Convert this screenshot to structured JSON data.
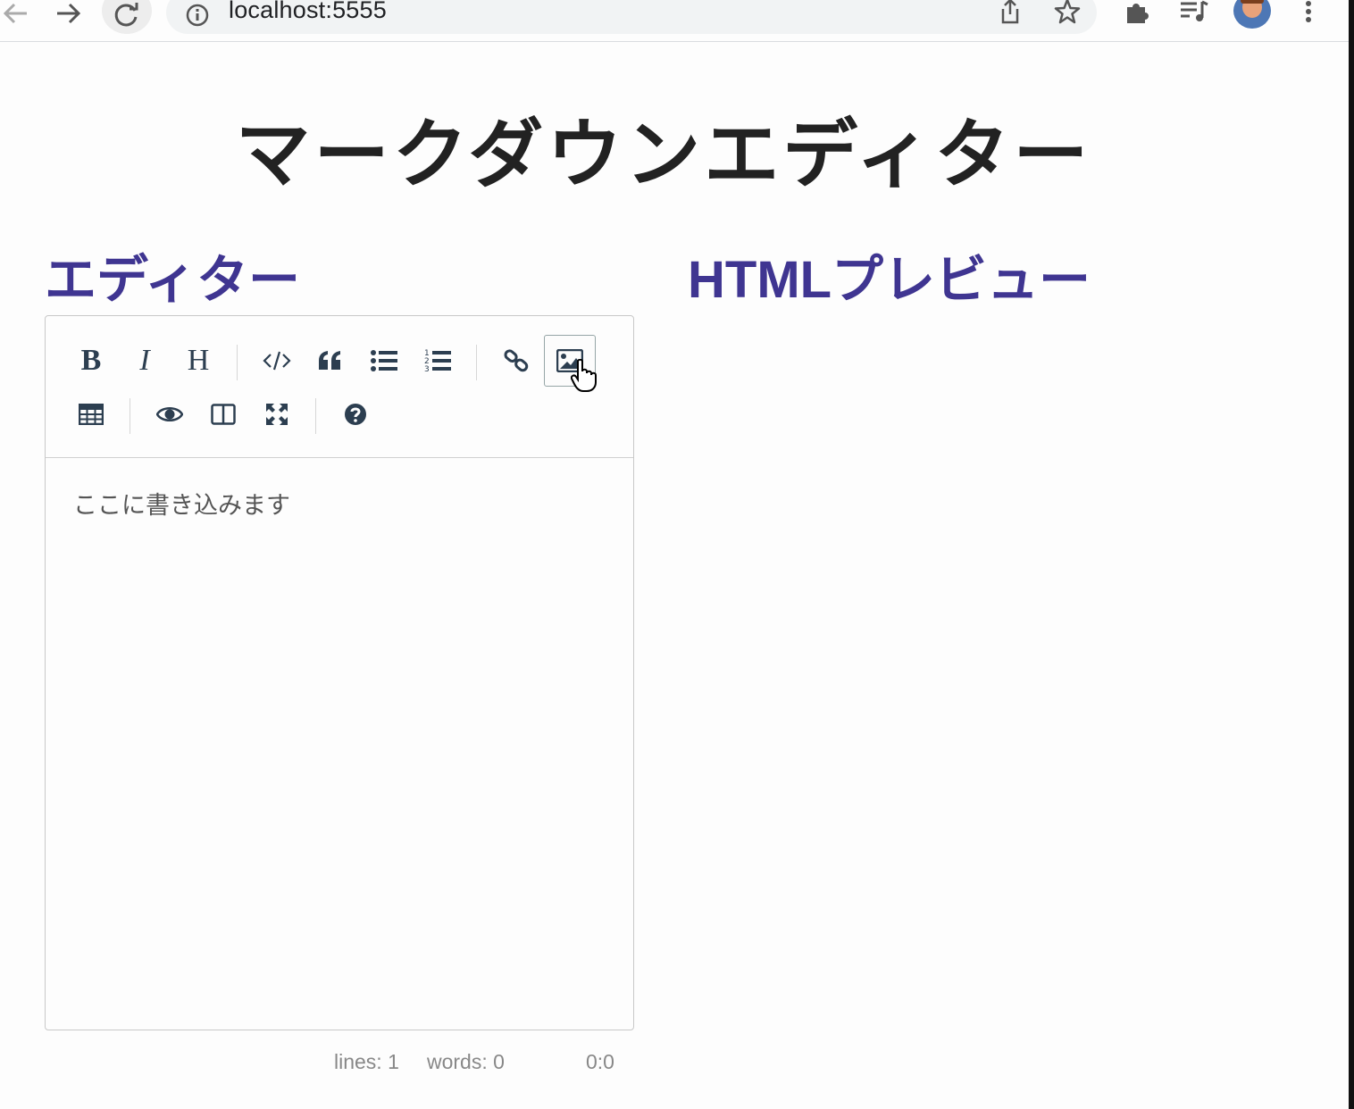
{
  "browser": {
    "url": "localhost:5555"
  },
  "page": {
    "title": "マークダウンエディター",
    "editor_heading": "エディター",
    "preview_heading": "HTMLプレビュー"
  },
  "toolbar": {
    "row1": [
      {
        "name": "bold-button",
        "label": "B",
        "icon": "bold"
      },
      {
        "name": "italic-button",
        "label": "I",
        "icon": "italic"
      },
      {
        "name": "heading-button",
        "label": "H",
        "icon": "heading"
      },
      {
        "name": "code-button",
        "icon": "code-icon"
      },
      {
        "name": "quote-button",
        "icon": "quote-icon"
      },
      {
        "name": "unordered-list-button",
        "icon": "bullet-list-icon"
      },
      {
        "name": "ordered-list-button",
        "icon": "numbered-list-icon"
      },
      {
        "name": "link-button",
        "icon": "link-icon"
      },
      {
        "name": "image-button",
        "icon": "image-icon",
        "active": true
      }
    ],
    "row2": [
      {
        "name": "table-button",
        "icon": "table-icon"
      },
      {
        "name": "preview-button",
        "icon": "eye-icon"
      },
      {
        "name": "side-by-side-button",
        "icon": "columns-icon"
      },
      {
        "name": "fullscreen-button",
        "icon": "expand-icon"
      },
      {
        "name": "guide-button",
        "icon": "question-icon"
      }
    ]
  },
  "editor": {
    "text": "ここに書き込みます"
  },
  "statusbar": {
    "lines": "lines: 1",
    "words": "words: 0",
    "cursor": "0:0"
  },
  "colors": {
    "heading": "#3f3591",
    "icon": "#2c3e50"
  }
}
